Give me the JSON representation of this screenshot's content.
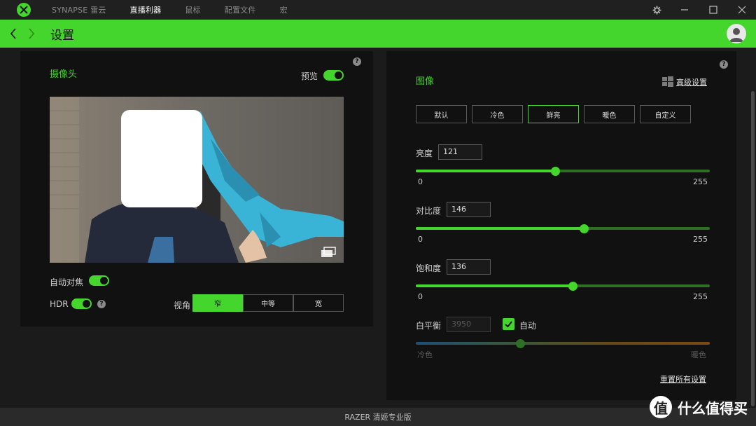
{
  "titlebar": {
    "tabs": [
      "SYNAPSE 雷云",
      "直播利器",
      "鼠标",
      "配置文件",
      "宏"
    ],
    "active_tab": 1
  },
  "header": {
    "title": "设置"
  },
  "camera_panel": {
    "title": "摄像头",
    "preview_label": "预览",
    "preview_on": true,
    "autofocus_label": "自动对焦",
    "autofocus_on": true,
    "hdr_label": "HDR",
    "hdr_on": true,
    "fov_label": "视角",
    "fov_options": [
      "窄",
      "中等",
      "宽"
    ],
    "fov_selected": 0
  },
  "image_panel": {
    "title": "图像",
    "advanced_label": "高级设置",
    "presets": [
      "默认",
      "冷色",
      "鲜亮",
      "暖色",
      "自定义"
    ],
    "preset_selected": 2,
    "brightness": {
      "label": "亮度",
      "value": "121",
      "min": "0",
      "max": "255",
      "fraction": 0.475
    },
    "contrast": {
      "label": "对比度",
      "value": "146",
      "min": "0",
      "max": "255",
      "fraction": 0.572
    },
    "saturation": {
      "label": "饱和度",
      "value": "136",
      "min": "0",
      "max": "255",
      "fraction": 0.534
    },
    "white_balance": {
      "label": "白平衡",
      "value": "3950",
      "auto_label": "自动",
      "auto_checked": true,
      "cool_label": "冷色",
      "warm_label": "暖色",
      "fraction": 0.357
    },
    "reset_label": "重置所有设置"
  },
  "footer": {
    "text": "RAZER 清姬专业版"
  },
  "watermark": {
    "badge": "值",
    "text": "什么值得买"
  },
  "colors": {
    "accent": "#44d62c",
    "panel": "#111111",
    "background": "#1b1b1b"
  }
}
